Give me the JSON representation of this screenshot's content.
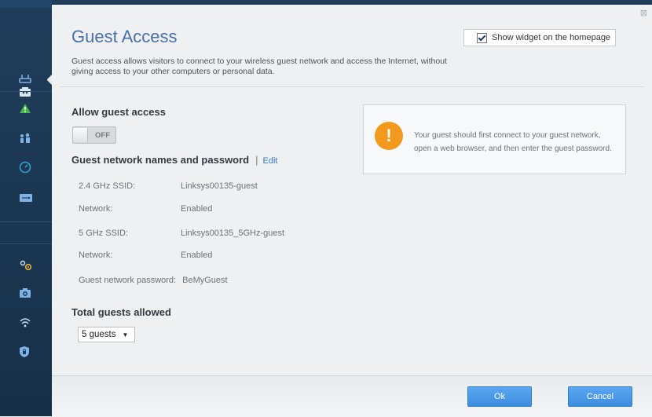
{
  "sidebar": {
    "items": [
      {
        "icon": "router-icon"
      },
      {
        "icon": "guest-access-icon",
        "active": true
      },
      {
        "icon": "warning-icon"
      },
      {
        "icon": "parental-controls-icon"
      },
      {
        "icon": "speed-test-icon"
      },
      {
        "icon": "usb-storage-icon"
      },
      {
        "icon": "settings-gears-icon"
      },
      {
        "icon": "troubleshooting-icon"
      },
      {
        "icon": "wireless-icon"
      },
      {
        "icon": "security-shield-icon"
      }
    ]
  },
  "page": {
    "title": "Guest Access",
    "close_glyph": "⊠",
    "widget_label": "Show widget on the homepage",
    "widget_checked": true,
    "intro": "Guest access allows visitors to connect to your wireless guest network and access the Internet, without giving access to your other computers or personal data."
  },
  "allow": {
    "heading": "Allow guest access",
    "toggle_label": "OFF"
  },
  "networks": {
    "heading": "Guest network names and password",
    "separator": "|",
    "edit_label": "Edit",
    "rows": [
      {
        "label": "2.4 GHz SSID:",
        "value": "Linksys00135-guest"
      },
      {
        "label": "Network:",
        "value": "Enabled"
      },
      {
        "label": "5 GHz SSID:",
        "value": "Linksys00135_5GHz-guest"
      },
      {
        "label": "Network:",
        "value": "Enabled"
      }
    ],
    "password_label": "Guest network password:",
    "password_value": "BeMyGuest"
  },
  "info": {
    "icon_glyph": "!",
    "line1": "Your guest should first connect to your guest network,",
    "line2": "open a web browser, and then enter the guest password."
  },
  "guests": {
    "heading": "Total guests allowed",
    "selected": "5 guests",
    "arrow": "▼"
  },
  "footer": {
    "ok_label": "Ok",
    "cancel_label": "Cancel"
  },
  "colors": {
    "accent": "#3d8de0",
    "title": "#4a6fa8",
    "warning": "#f39a1e",
    "sidebar": "#1f3d5a"
  }
}
